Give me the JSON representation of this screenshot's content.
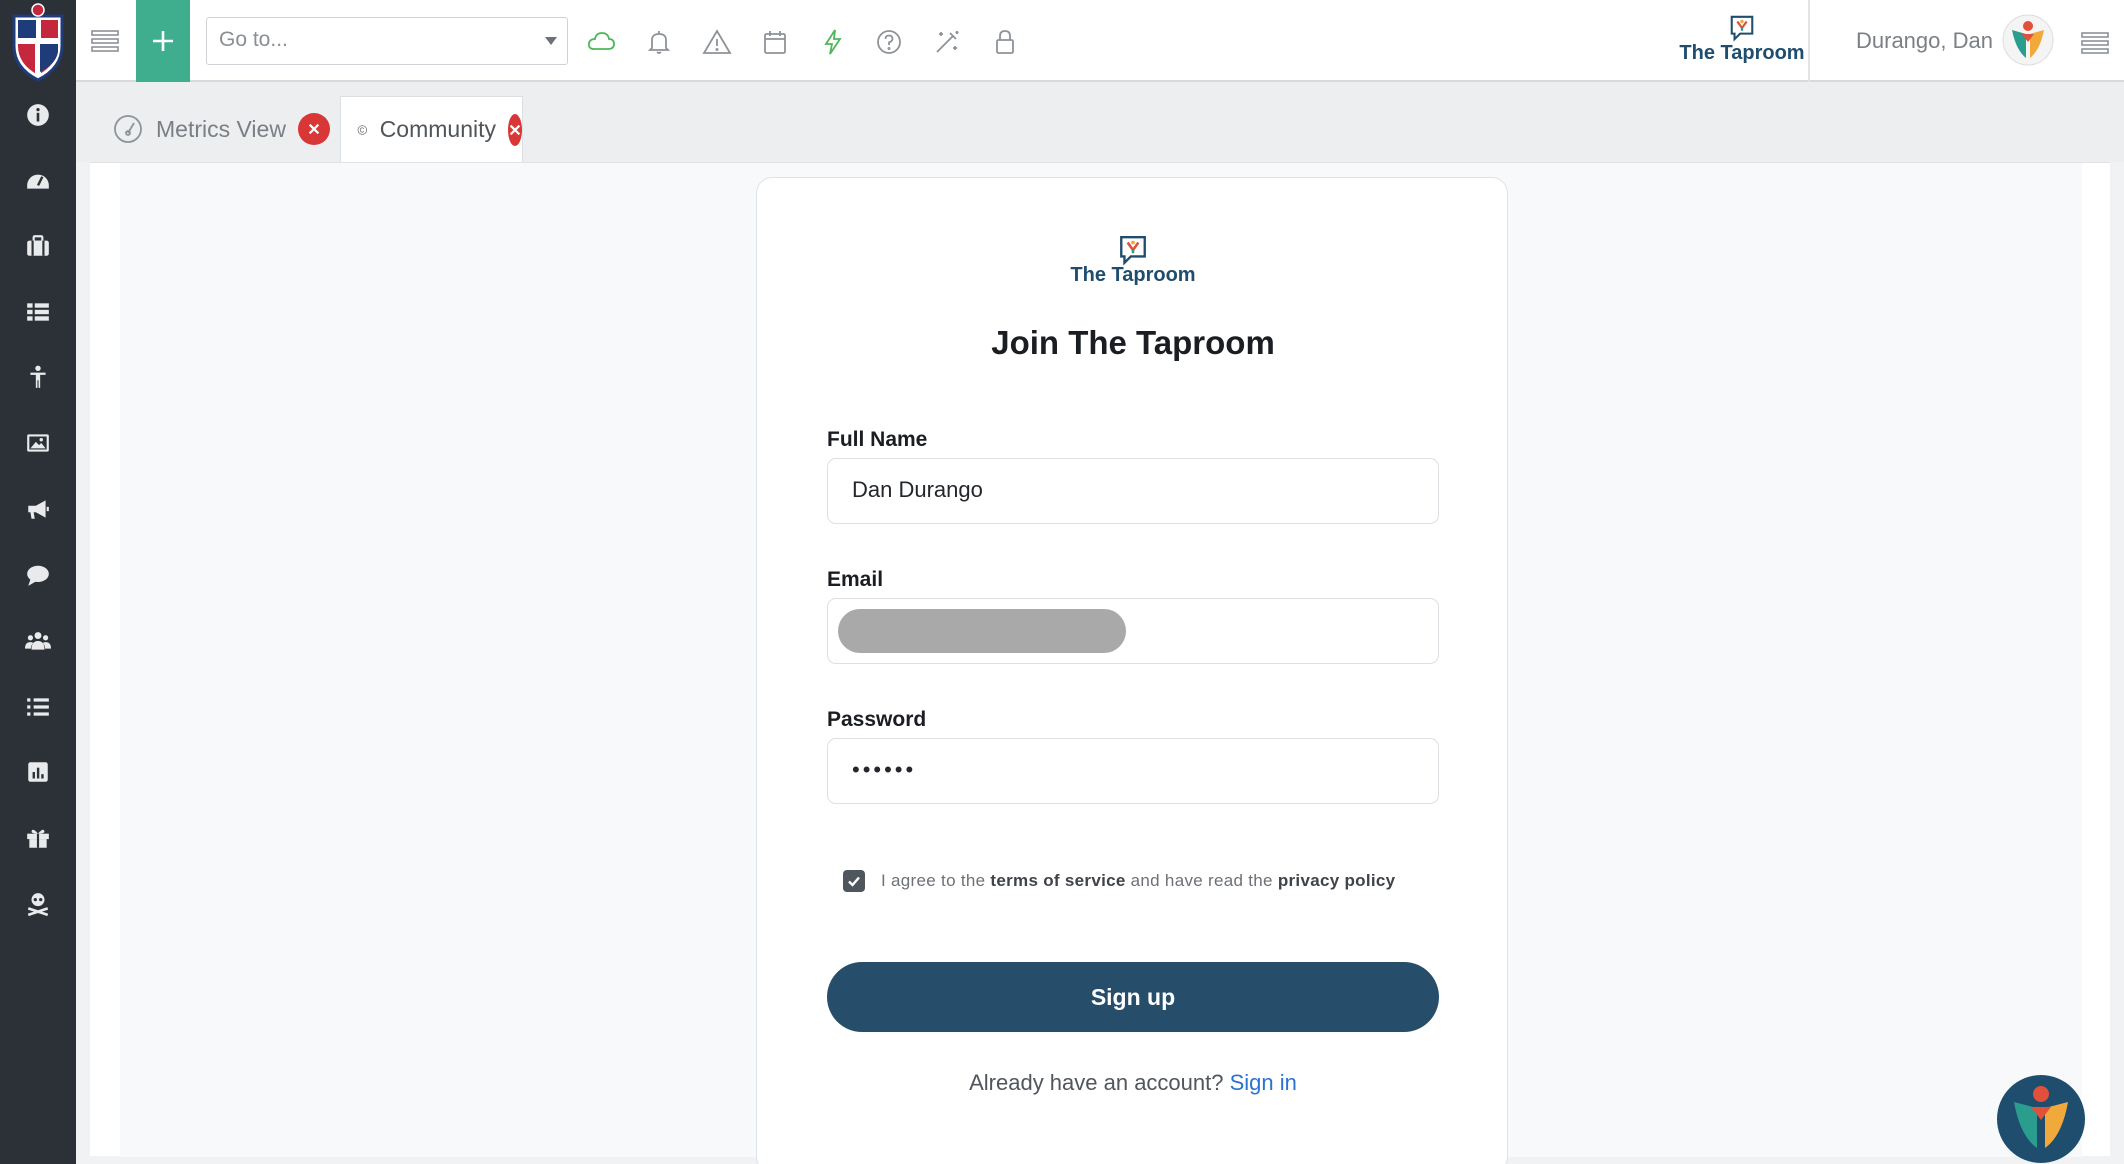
{
  "topbar": {
    "goto_placeholder": "Go to...",
    "brand_name": "The Taproom",
    "user_name": "Durango, Dan",
    "accent_color": "#3fae8f",
    "icons": [
      "cloud-icon",
      "bell-icon",
      "warning-icon",
      "calendar-icon",
      "lightning-icon",
      "help-icon",
      "magic-wand-icon",
      "lock-icon"
    ]
  },
  "sidebar": {
    "items": [
      "info-icon",
      "dashboard-icon",
      "briefcase-icon",
      "list-view-icon",
      "person-icon",
      "image-icon",
      "megaphone-icon",
      "chat-icon",
      "group-icon",
      "checklist-icon",
      "bar-chart-icon",
      "gift-icon",
      "skull-icon"
    ]
  },
  "tabs": [
    {
      "label": "Metrics View",
      "active": false
    },
    {
      "label": "Community",
      "active": true
    }
  ],
  "form": {
    "brand_name": "The Taproom",
    "title": "Join The Taproom",
    "full_name_label": "Full Name",
    "full_name_value": "Dan Durango",
    "email_label": "Email",
    "password_label": "Password",
    "password_value": "••••••",
    "agree_prefix": "I agree to the ",
    "terms_label": "terms of service",
    "agree_middle": " and have read the ",
    "privacy_label": "privacy policy",
    "agree_checked": true,
    "signup_label": "Sign up",
    "already_text": "Already have an account?",
    "signin_label": "Sign in",
    "primary_color": "#264e6b",
    "link_color": "#2a72d4"
  }
}
